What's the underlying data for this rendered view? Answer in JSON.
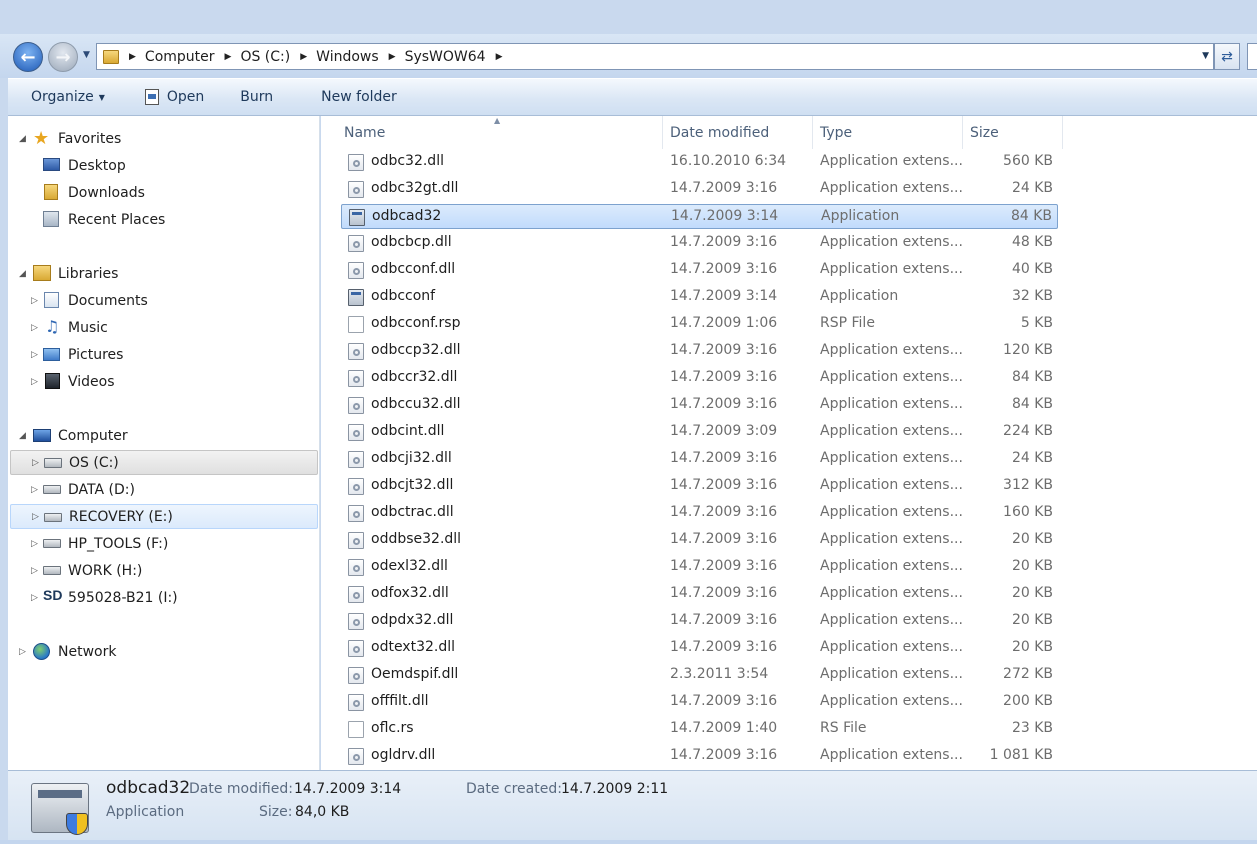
{
  "address_bar": {
    "path": [
      "Computer",
      "OS (C:)",
      "Windows",
      "SysWOW64"
    ]
  },
  "toolbar": {
    "organize_label": "Organize",
    "open_label": "Open",
    "burn_label": "Burn",
    "new_folder_label": "New folder"
  },
  "nav": {
    "favorites": "Favorites",
    "desktop": "Desktop",
    "downloads": "Downloads",
    "recent_places": "Recent Places",
    "libraries": "Libraries",
    "documents": "Documents",
    "music": "Music",
    "pictures": "Pictures",
    "videos": "Videos",
    "computer": "Computer",
    "drive_c": "OS (C:)",
    "drive_d": "DATA (D:)",
    "drive_e": "RECOVERY (E:)",
    "drive_f": "HP_TOOLS (F:)",
    "drive_h": "WORK (H:)",
    "drive_i": "595028-B21 (I:)",
    "sd_icon_text": "SD",
    "network": "Network"
  },
  "columns": {
    "name": "Name",
    "date": "Date modified",
    "type": "Type",
    "size": "Size"
  },
  "files": [
    {
      "name": "odbc32.dll",
      "date": "16.10.2010 6:34",
      "type": "Application extens...",
      "size": "560 KB",
      "icon": "dll-icon"
    },
    {
      "name": "odbc32gt.dll",
      "date": "14.7.2009 3:16",
      "type": "Application extens...",
      "size": "24 KB",
      "icon": "dll-icon"
    },
    {
      "name": "odbcad32",
      "date": "14.7.2009 3:14",
      "type": "Application",
      "size": "84 KB",
      "icon": "app-icon"
    },
    {
      "name": "odbcbcp.dll",
      "date": "14.7.2009 3:16",
      "type": "Application extens...",
      "size": "48 KB",
      "icon": "dll-icon"
    },
    {
      "name": "odbcconf.dll",
      "date": "14.7.2009 3:16",
      "type": "Application extens...",
      "size": "40 KB",
      "icon": "dll-icon"
    },
    {
      "name": "odbcconf",
      "date": "14.7.2009 3:14",
      "type": "Application",
      "size": "32 KB",
      "icon": "app-icon"
    },
    {
      "name": "odbcconf.rsp",
      "date": "14.7.2009 1:06",
      "type": "RSP File",
      "size": "5 KB",
      "icon": "file-icon"
    },
    {
      "name": "odbccp32.dll",
      "date": "14.7.2009 3:16",
      "type": "Application extens...",
      "size": "120 KB",
      "icon": "dll-icon"
    },
    {
      "name": "odbccr32.dll",
      "date": "14.7.2009 3:16",
      "type": "Application extens...",
      "size": "84 KB",
      "icon": "dll-icon"
    },
    {
      "name": "odbccu32.dll",
      "date": "14.7.2009 3:16",
      "type": "Application extens...",
      "size": "84 KB",
      "icon": "dll-icon"
    },
    {
      "name": "odbcint.dll",
      "date": "14.7.2009 3:09",
      "type": "Application extens...",
      "size": "224 KB",
      "icon": "dll-icon"
    },
    {
      "name": "odbcji32.dll",
      "date": "14.7.2009 3:16",
      "type": "Application extens...",
      "size": "24 KB",
      "icon": "dll-icon"
    },
    {
      "name": "odbcjt32.dll",
      "date": "14.7.2009 3:16",
      "type": "Application extens...",
      "size": "312 KB",
      "icon": "dll-icon"
    },
    {
      "name": "odbctrac.dll",
      "date": "14.7.2009 3:16",
      "type": "Application extens...",
      "size": "160 KB",
      "icon": "dll-icon"
    },
    {
      "name": "oddbse32.dll",
      "date": "14.7.2009 3:16",
      "type": "Application extens...",
      "size": "20 KB",
      "icon": "dll-icon"
    },
    {
      "name": "odexl32.dll",
      "date": "14.7.2009 3:16",
      "type": "Application extens...",
      "size": "20 KB",
      "icon": "dll-icon"
    },
    {
      "name": "odfox32.dll",
      "date": "14.7.2009 3:16",
      "type": "Application extens...",
      "size": "20 KB",
      "icon": "dll-icon"
    },
    {
      "name": "odpdx32.dll",
      "date": "14.7.2009 3:16",
      "type": "Application extens...",
      "size": "20 KB",
      "icon": "dll-icon"
    },
    {
      "name": "odtext32.dll",
      "date": "14.7.2009 3:16",
      "type": "Application extens...",
      "size": "20 KB",
      "icon": "dll-icon"
    },
    {
      "name": "Oemdspif.dll",
      "date": "2.3.2011 3:54",
      "type": "Application extens...",
      "size": "272 KB",
      "icon": "dll-icon"
    },
    {
      "name": "offfilt.dll",
      "date": "14.7.2009 3:16",
      "type": "Application extens...",
      "size": "200 KB",
      "icon": "dll-icon"
    },
    {
      "name": "oflc.rs",
      "date": "14.7.2009 1:40",
      "type": "RS File",
      "size": "23 KB",
      "icon": "file-icon"
    },
    {
      "name": "ogldrv.dll",
      "date": "14.7.2009 3:16",
      "type": "Application extens...",
      "size": "1 081 KB",
      "icon": "dll-icon"
    }
  ],
  "details": {
    "name": "odbcad32",
    "type": "Application",
    "date_modified_label": "Date modified:",
    "date_modified": "14.7.2009 3:14",
    "size_label": "Size:",
    "size": "84,0 KB",
    "date_created_label": "Date created:",
    "date_created": "14.7.2009 2:11"
  }
}
